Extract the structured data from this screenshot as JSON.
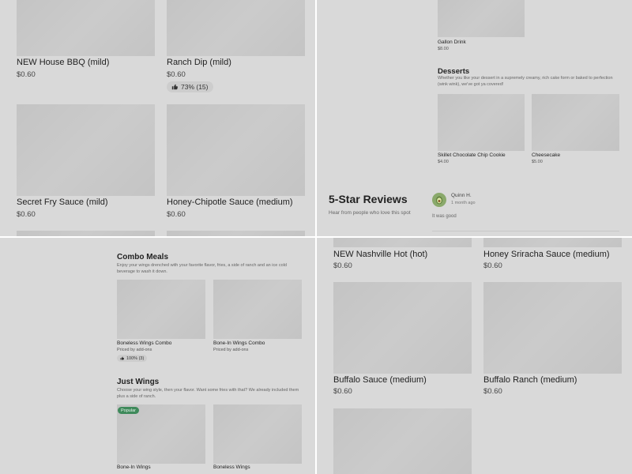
{
  "top_left": {
    "items": [
      {
        "name": "NEW House BBQ (mild)",
        "price": "$0.60"
      },
      {
        "name": "Ranch Dip (mild)",
        "price": "$0.60",
        "rating": "73% (15)"
      },
      {
        "name": "Secret Fry Sauce (mild)",
        "price": "$0.60"
      },
      {
        "name": "Honey-Chipotle Sauce (medium)",
        "price": "$0.60"
      }
    ]
  },
  "top_right": {
    "gallon": {
      "name": "Gallon Drink",
      "price": "$8.00"
    },
    "desserts": {
      "title": "Desserts",
      "description": "Whether you like your dessert in a supremely creamy, rich cake form or baked to perfection (wink wink), we've got ya covered!",
      "items": [
        {
          "name": "Skillet Chocolate Chip Cookie",
          "price": "$4.00"
        },
        {
          "name": "Cheesecake",
          "price": "$5.00"
        }
      ]
    },
    "reviews": {
      "title": "5-Star Reviews",
      "subtitle": "Hear from people who love this spot",
      "reviewer": "Quinn H.",
      "date": "1 month ago",
      "text": "It was good"
    }
  },
  "bottom_left": {
    "combo": {
      "title": "Combo Meals",
      "description": "Enjoy your wings drenched with your favorite flavor, fries, a side of ranch and an ice cold beverage to wash it down.",
      "items": [
        {
          "name": "Boneless Wings Combo",
          "price": "Priced by add-ons",
          "rating": "100% (3)"
        },
        {
          "name": "Bone-In Wings Combo",
          "price": "Priced by add-ons"
        }
      ]
    },
    "just_wings": {
      "title": "Just Wings",
      "description": "Choose your wing style, then your flavor. Want some fries with that? We already included them plus a side of ranch.",
      "badge": "Popular",
      "items": [
        {
          "name": "Bone-In Wings"
        },
        {
          "name": "Boneless Wings"
        }
      ]
    }
  },
  "bottom_right": {
    "items": [
      {
        "name": "NEW Nashville Hot (hot)",
        "price": "$0.60"
      },
      {
        "name": "Honey Sriracha Sauce (medium)",
        "price": "$0.60"
      },
      {
        "name": "Buffalo Sauce (medium)",
        "price": "$0.60"
      },
      {
        "name": "Buffalo Ranch (medium)",
        "price": "$0.60"
      }
    ]
  },
  "colors": {
    "background": "#d9d9d9",
    "image_placeholder": "#c4c4c4",
    "popular_badge": "#3f8a5b",
    "avatar": "#8aa96b"
  },
  "icons": [
    "thumbs-up-icon",
    "avocado-avatar-icon"
  ]
}
